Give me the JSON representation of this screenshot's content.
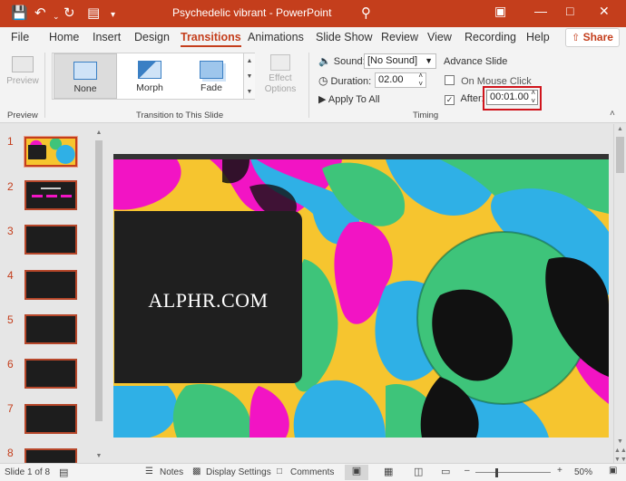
{
  "titlebar": {
    "title": "Psychedelic vibrant  -  PowerPoint",
    "icons": [
      "save-icon",
      "undo-icon",
      "redo-icon",
      "present-icon",
      "customize-icon",
      "search-icon",
      "ribbon-display-icon",
      "minimize-icon",
      "maximize-icon",
      "close-icon"
    ]
  },
  "menu": {
    "tabs": [
      "File",
      "Home",
      "Insert",
      "Design",
      "Transitions",
      "Animations",
      "Slide Show",
      "Review",
      "View",
      "Recording",
      "Help"
    ],
    "active": "Transitions",
    "share": "Share"
  },
  "ribbon": {
    "preview": {
      "label": "Preview",
      "group": "Preview"
    },
    "transitions": {
      "group": "Transition to This Slide",
      "items": [
        "None",
        "Morph",
        "Fade"
      ],
      "selected": "None",
      "effect_options": "Effect\nOptions"
    },
    "timing": {
      "group": "Timing",
      "sound_label": "Sound:",
      "sound_value": "[No Sound]",
      "duration_label": "Duration:",
      "duration_value": "02.00",
      "apply_all": "Apply To All",
      "advance_label": "Advance Slide",
      "on_click_label": "On Mouse Click",
      "on_click_checked": false,
      "after_label": "After:",
      "after_checked": true,
      "after_value": "00:01.00"
    }
  },
  "thumbnails": {
    "numbers": [
      "1",
      "2",
      "3",
      "4",
      "5",
      "6",
      "7",
      "8"
    ],
    "selected": "1"
  },
  "slide": {
    "title_text": "ALPHR.COM",
    "colors": {
      "yellow": "#f6c52f",
      "magenta": "#f214c4",
      "cyan": "#2fb0e6",
      "green": "#3ec47a",
      "black": "#111111"
    }
  },
  "statusbar": {
    "slide_info": "Slide 1 of 8",
    "notes": "Notes",
    "display_settings": "Display Settings",
    "comments": "Comments",
    "zoom": "50%"
  }
}
